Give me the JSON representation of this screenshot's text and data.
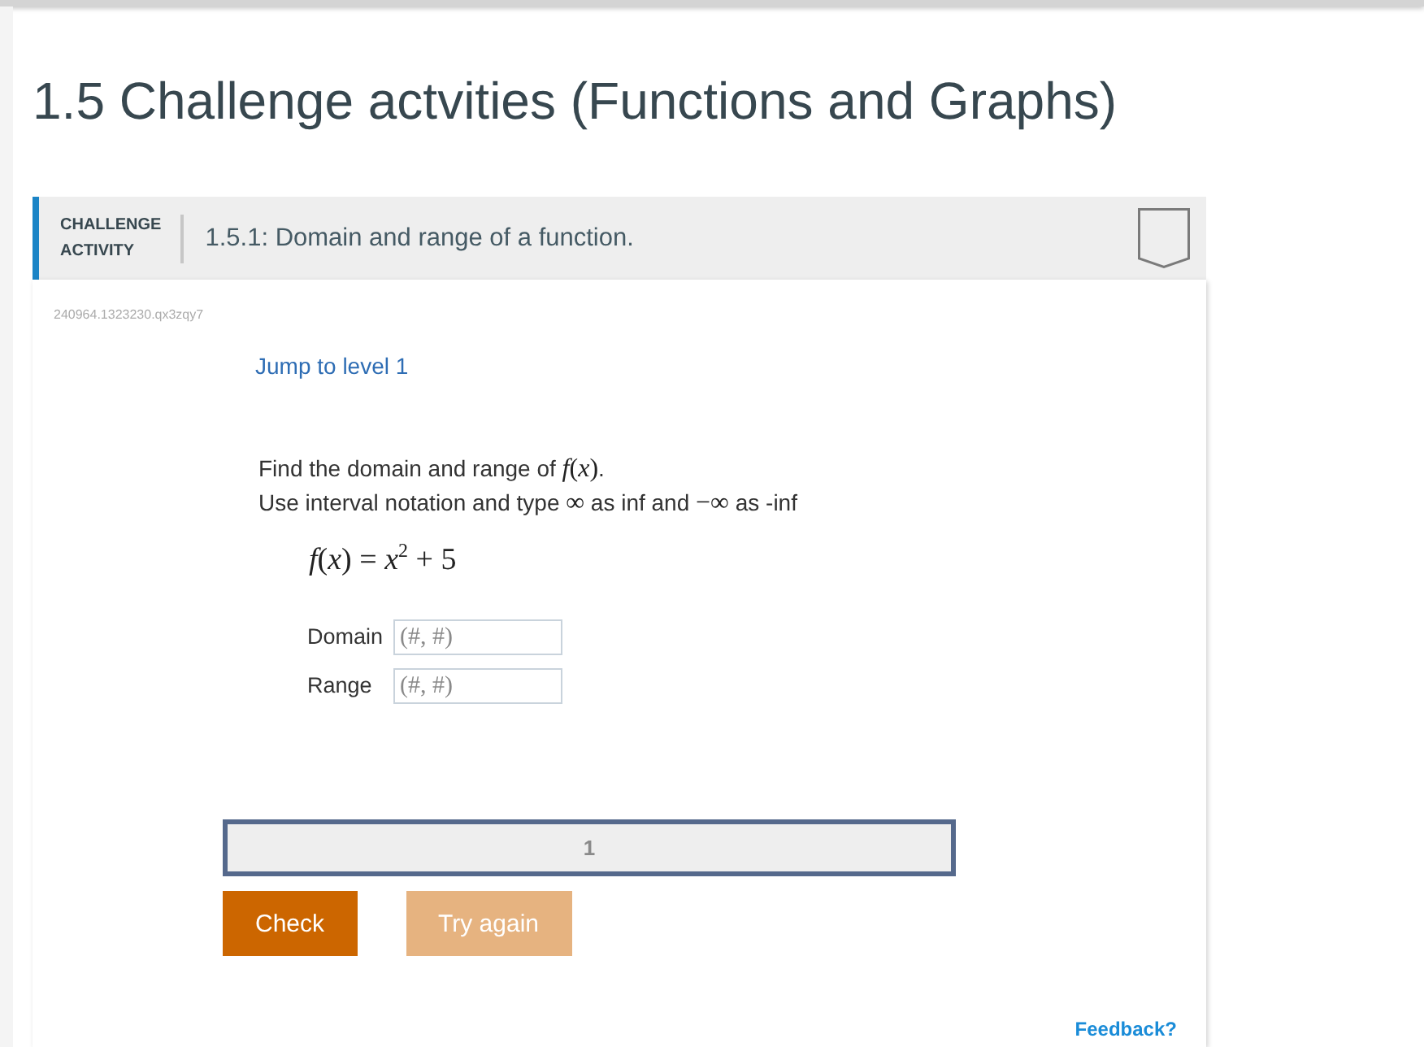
{
  "page": {
    "title": "1.5 Challenge actvities (Functions and Graphs)"
  },
  "activity": {
    "type_label": "CHALLENGE ACTIVITY",
    "title": "1.5.1: Domain and range of a function.",
    "completed": false,
    "id_code": "240964.1323230.qx3zqy7"
  },
  "jump_link": "Jump to level 1",
  "instructions": [
    [
      {
        "kind": "text",
        "text": "Find the domain and range of "
      },
      {
        "kind": "math",
        "text": "*f*(*x*)"
      },
      {
        "kind": "text",
        "text": "."
      }
    ],
    [
      {
        "kind": "text",
        "text": "Use interval notation and type "
      },
      {
        "kind": "math",
        "text": "∞"
      },
      {
        "kind": "text",
        "text": " as inf and "
      },
      {
        "kind": "math",
        "text": "−∞"
      },
      {
        "kind": "text",
        "text": " as -inf"
      }
    ]
  ],
  "equation": "*f*(*x*) = *x*$^{2}$ + 5",
  "fields": [
    {
      "label": "Domain",
      "placeholder": "(#, #)"
    },
    {
      "label": "Range",
      "placeholder": "(#, #)"
    }
  ],
  "levels": [
    {
      "label": "1",
      "selected": true
    }
  ],
  "buttons": [
    {
      "label": "Check",
      "disabled": false
    },
    {
      "label": "Try again",
      "disabled": true
    }
  ],
  "feedback_link": "Feedback?"
}
